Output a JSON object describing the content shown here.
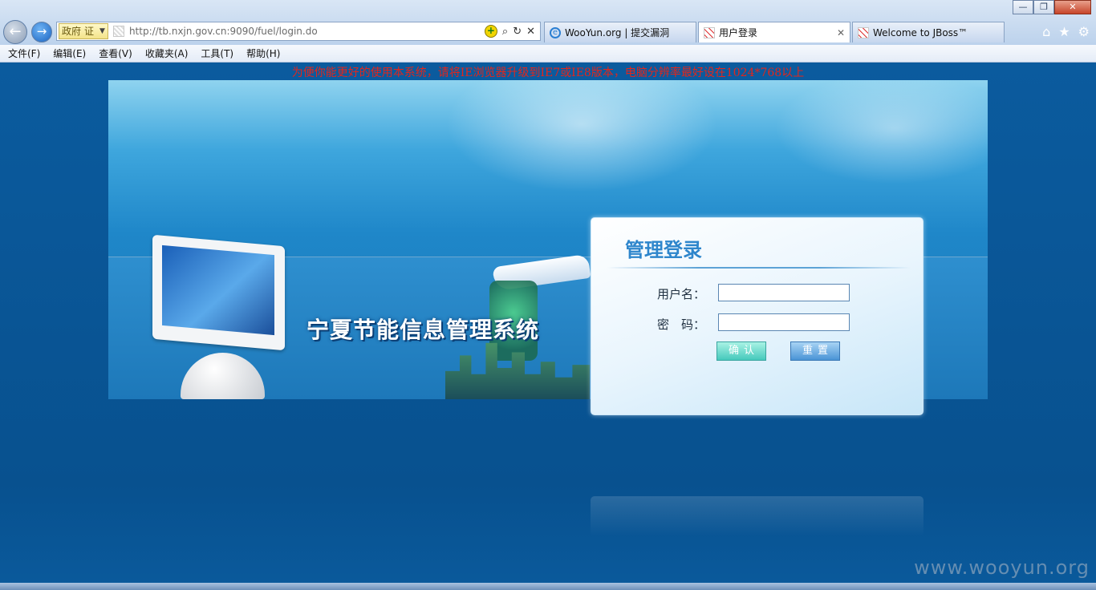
{
  "window_controls": {
    "minimize": "—",
    "maximize": "❐",
    "close": "✕"
  },
  "address_bar": {
    "zone_label": "政府",
    "zone_cert": "证",
    "url": "http://tb.nxjn.gov.cn:9090/fuel/login.do",
    "compat_icon": "compat-view-icon",
    "search_glyph": "⌕",
    "refresh_glyph": "↻",
    "stop_glyph": "✕"
  },
  "tabs": [
    {
      "title": "WooYun.org | 提交漏洞",
      "icon": "ie-icon"
    },
    {
      "title": "用户登录",
      "icon": "page-icon",
      "active": true,
      "close": "✕"
    },
    {
      "title": "Welcome to JBoss™",
      "icon": "page-icon"
    }
  ],
  "toolbar_icons": {
    "home": "⌂",
    "favorites": "★",
    "tools": "⚙"
  },
  "menu": [
    "文件(F)",
    "编辑(E)",
    "查看(V)",
    "收藏夹(A)",
    "工具(T)",
    "帮助(H)"
  ],
  "page": {
    "notice": "为便你能更好的使用本系统，请将IE浏览器升级到IE7或IE8版本，电脑分辨率最好设在1024*768以上",
    "system_title": "宁夏节能信息管理系统",
    "login": {
      "title": "管理登录",
      "username_label": "用户名：",
      "password_label": "密　码：",
      "username_value": "",
      "password_value": "",
      "confirm_label": "确认",
      "reset_label": "重置"
    }
  },
  "watermark": "www.wooyun.org",
  "colors": {
    "notice": "#e3261b",
    "login_title": "#2e86cc",
    "page_bg": "#0a5a9c"
  }
}
